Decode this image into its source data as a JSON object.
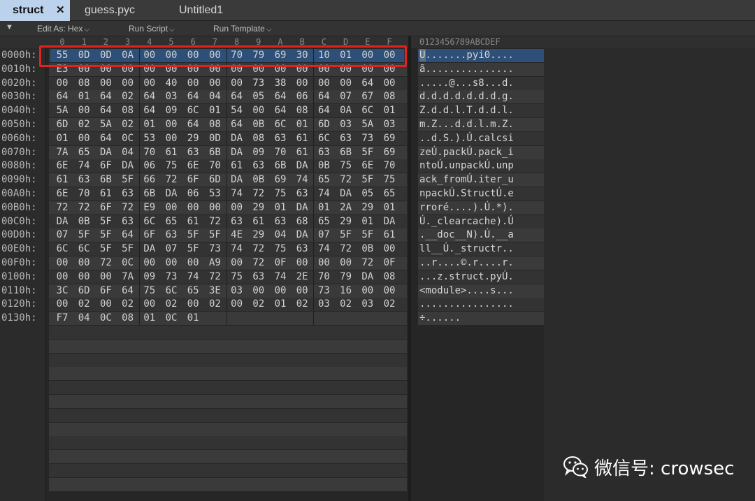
{
  "tabs": [
    {
      "label": "struct",
      "active": true
    },
    {
      "label": "guess.pyc",
      "active": false
    },
    {
      "label": "Untitled1",
      "active": false
    }
  ],
  "close_glyph": "✕",
  "toolbar": {
    "collapse_glyph": "▼",
    "edit_as": "Edit As: Hex",
    "run_script": "Run Script",
    "run_template": "Run Template",
    "chevron": "⌵"
  },
  "columns": {
    "hex": [
      "0",
      "1",
      "2",
      "3",
      "4",
      "5",
      "6",
      "7",
      "8",
      "9",
      "A",
      "B",
      "C",
      "D",
      "E",
      "F"
    ],
    "ascii": "0123456789ABCDEF"
  },
  "rows": [
    {
      "addr": "0000h:",
      "hex": [
        "55",
        "0D",
        "0D",
        "0A",
        "00",
        "00",
        "00",
        "00",
        "70",
        "79",
        "69",
        "30",
        "10",
        "01",
        "00",
        "00"
      ],
      "ascii": "U.......pyi0...."
    },
    {
      "addr": "0010h:",
      "hex": [
        "E3",
        "00",
        "00",
        "00",
        "00",
        "00",
        "00",
        "00",
        "00",
        "00",
        "00",
        "00",
        "00",
        "00",
        "00",
        "00"
      ],
      "ascii": "ã..............."
    },
    {
      "addr": "0020h:",
      "hex": [
        "00",
        "08",
        "00",
        "00",
        "00",
        "40",
        "00",
        "00",
        "00",
        "73",
        "38",
        "00",
        "00",
        "00",
        "64",
        "00"
      ],
      "ascii": ".....@...s8...d."
    },
    {
      "addr": "0030h:",
      "hex": [
        "64",
        "01",
        "64",
        "02",
        "64",
        "03",
        "64",
        "04",
        "64",
        "05",
        "64",
        "06",
        "64",
        "07",
        "67",
        "08"
      ],
      "ascii": "d.d.d.d.d.d.d.g."
    },
    {
      "addr": "0040h:",
      "hex": [
        "5A",
        "00",
        "64",
        "08",
        "64",
        "09",
        "6C",
        "01",
        "54",
        "00",
        "64",
        "08",
        "64",
        "0A",
        "6C",
        "01"
      ],
      "ascii": "Z.d.d.l.T.d.d.l."
    },
    {
      "addr": "0050h:",
      "hex": [
        "6D",
        "02",
        "5A",
        "02",
        "01",
        "00",
        "64",
        "08",
        "64",
        "0B",
        "6C",
        "01",
        "6D",
        "03",
        "5A",
        "03"
      ],
      "ascii": "m.Z...d.d.l.m.Z."
    },
    {
      "addr": "0060h:",
      "hex": [
        "01",
        "00",
        "64",
        "0C",
        "53",
        "00",
        "29",
        "0D",
        "DA",
        "08",
        "63",
        "61",
        "6C",
        "63",
        "73",
        "69"
      ],
      "ascii": "..d.S.).Ú.calcsi"
    },
    {
      "addr": "0070h:",
      "hex": [
        "7A",
        "65",
        "DA",
        "04",
        "70",
        "61",
        "63",
        "6B",
        "DA",
        "09",
        "70",
        "61",
        "63",
        "6B",
        "5F",
        "69"
      ],
      "ascii": "zeÚ.packÚ.pack_i"
    },
    {
      "addr": "0080h:",
      "hex": [
        "6E",
        "74",
        "6F",
        "DA",
        "06",
        "75",
        "6E",
        "70",
        "61",
        "63",
        "6B",
        "DA",
        "0B",
        "75",
        "6E",
        "70"
      ],
      "ascii": "ntoÚ.unpackÚ.unp"
    },
    {
      "addr": "0090h:",
      "hex": [
        "61",
        "63",
        "6B",
        "5F",
        "66",
        "72",
        "6F",
        "6D",
        "DA",
        "0B",
        "69",
        "74",
        "65",
        "72",
        "5F",
        "75"
      ],
      "ascii": "ack_fromÚ.iter_u"
    },
    {
      "addr": "00A0h:",
      "hex": [
        "6E",
        "70",
        "61",
        "63",
        "6B",
        "DA",
        "06",
        "53",
        "74",
        "72",
        "75",
        "63",
        "74",
        "DA",
        "05",
        "65"
      ],
      "ascii": "npackÚ.StructÚ.e"
    },
    {
      "addr": "00B0h:",
      "hex": [
        "72",
        "72",
        "6F",
        "72",
        "E9",
        "00",
        "00",
        "00",
        "00",
        "29",
        "01",
        "DA",
        "01",
        "2A",
        "29",
        "01"
      ],
      "ascii": "rroré....).Ú.*)."
    },
    {
      "addr": "00C0h:",
      "hex": [
        "DA",
        "0B",
        "5F",
        "63",
        "6C",
        "65",
        "61",
        "72",
        "63",
        "61",
        "63",
        "68",
        "65",
        "29",
        "01",
        "DA"
      ],
      "ascii": "Ú._clearcache).Ú"
    },
    {
      "addr": "00D0h:",
      "hex": [
        "07",
        "5F",
        "5F",
        "64",
        "6F",
        "63",
        "5F",
        "5F",
        "4E",
        "29",
        "04",
        "DA",
        "07",
        "5F",
        "5F",
        "61"
      ],
      "ascii": ".__doc__N).Ú.__a"
    },
    {
      "addr": "00E0h:",
      "hex": [
        "6C",
        "6C",
        "5F",
        "5F",
        "DA",
        "07",
        "5F",
        "73",
        "74",
        "72",
        "75",
        "63",
        "74",
        "72",
        "0B",
        "00"
      ],
      "ascii": "ll__Ú._structr.."
    },
    {
      "addr": "00F0h:",
      "hex": [
        "00",
        "00",
        "72",
        "0C",
        "00",
        "00",
        "00",
        "A9",
        "00",
        "72",
        "0F",
        "00",
        "00",
        "00",
        "72",
        "0F"
      ],
      "ascii": "..r....©.r....r."
    },
    {
      "addr": "0100h:",
      "hex": [
        "00",
        "00",
        "00",
        "7A",
        "09",
        "73",
        "74",
        "72",
        "75",
        "63",
        "74",
        "2E",
        "70",
        "79",
        "DA",
        "08"
      ],
      "ascii": "...z.struct.pyÚ."
    },
    {
      "addr": "0110h:",
      "hex": [
        "3C",
        "6D",
        "6F",
        "64",
        "75",
        "6C",
        "65",
        "3E",
        "03",
        "00",
        "00",
        "00",
        "73",
        "16",
        "00",
        "00"
      ],
      "ascii": "<module>....s..."
    },
    {
      "addr": "0120h:",
      "hex": [
        "00",
        "02",
        "00",
        "02",
        "00",
        "02",
        "00",
        "02",
        "00",
        "02",
        "01",
        "02",
        "03",
        "02",
        "03",
        "02"
      ],
      "ascii": "................"
    },
    {
      "addr": "0130h:",
      "hex": [
        "F7",
        "04",
        "0C",
        "08",
        "01",
        "0C",
        "01"
      ],
      "ascii": "÷......"
    }
  ],
  "empty_rows": 12,
  "selected_row": 0,
  "highlight_color": "#e0231c",
  "selection_color": "#2d4f78",
  "watermark": {
    "text": "微信号: crowsec",
    "icon": "wechat-icon"
  }
}
